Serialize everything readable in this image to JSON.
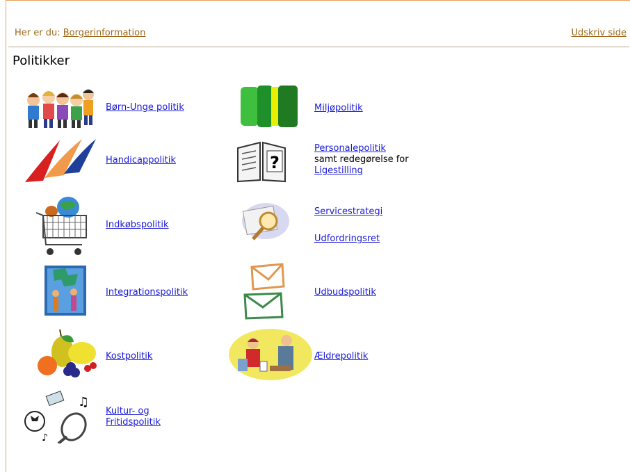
{
  "breadcrumb": {
    "prefix": "Her er du:",
    "current": "Borgerinformation",
    "print_label": "Udskriv side"
  },
  "page_title": "Politikker",
  "policies": {
    "born_unge": "Børn-Unge politik",
    "miljo": "Miljøpolitik",
    "handicap": "Handicappolitik",
    "personale": "Personalepolitik",
    "personale_note": "samt redegørelse for",
    "ligestilling": "Ligestilling",
    "indkob": "Indkøbspolitik",
    "servicestrategi": "Servicestrategi",
    "udfordringsret": "Udfordringsret",
    "integration": "Integrationspolitik",
    "udbud": "Udbudspolitik",
    "kost": "Kostpolitik",
    "aeldre": "Ældrepolitik",
    "kultur_line1": "Kultur- og",
    "kultur_line2": "Fritidspolitik"
  },
  "colors": {
    "frame": "#e8a25a",
    "breadcrumb": "#9a6a1c",
    "link": "#1a1ad6"
  }
}
